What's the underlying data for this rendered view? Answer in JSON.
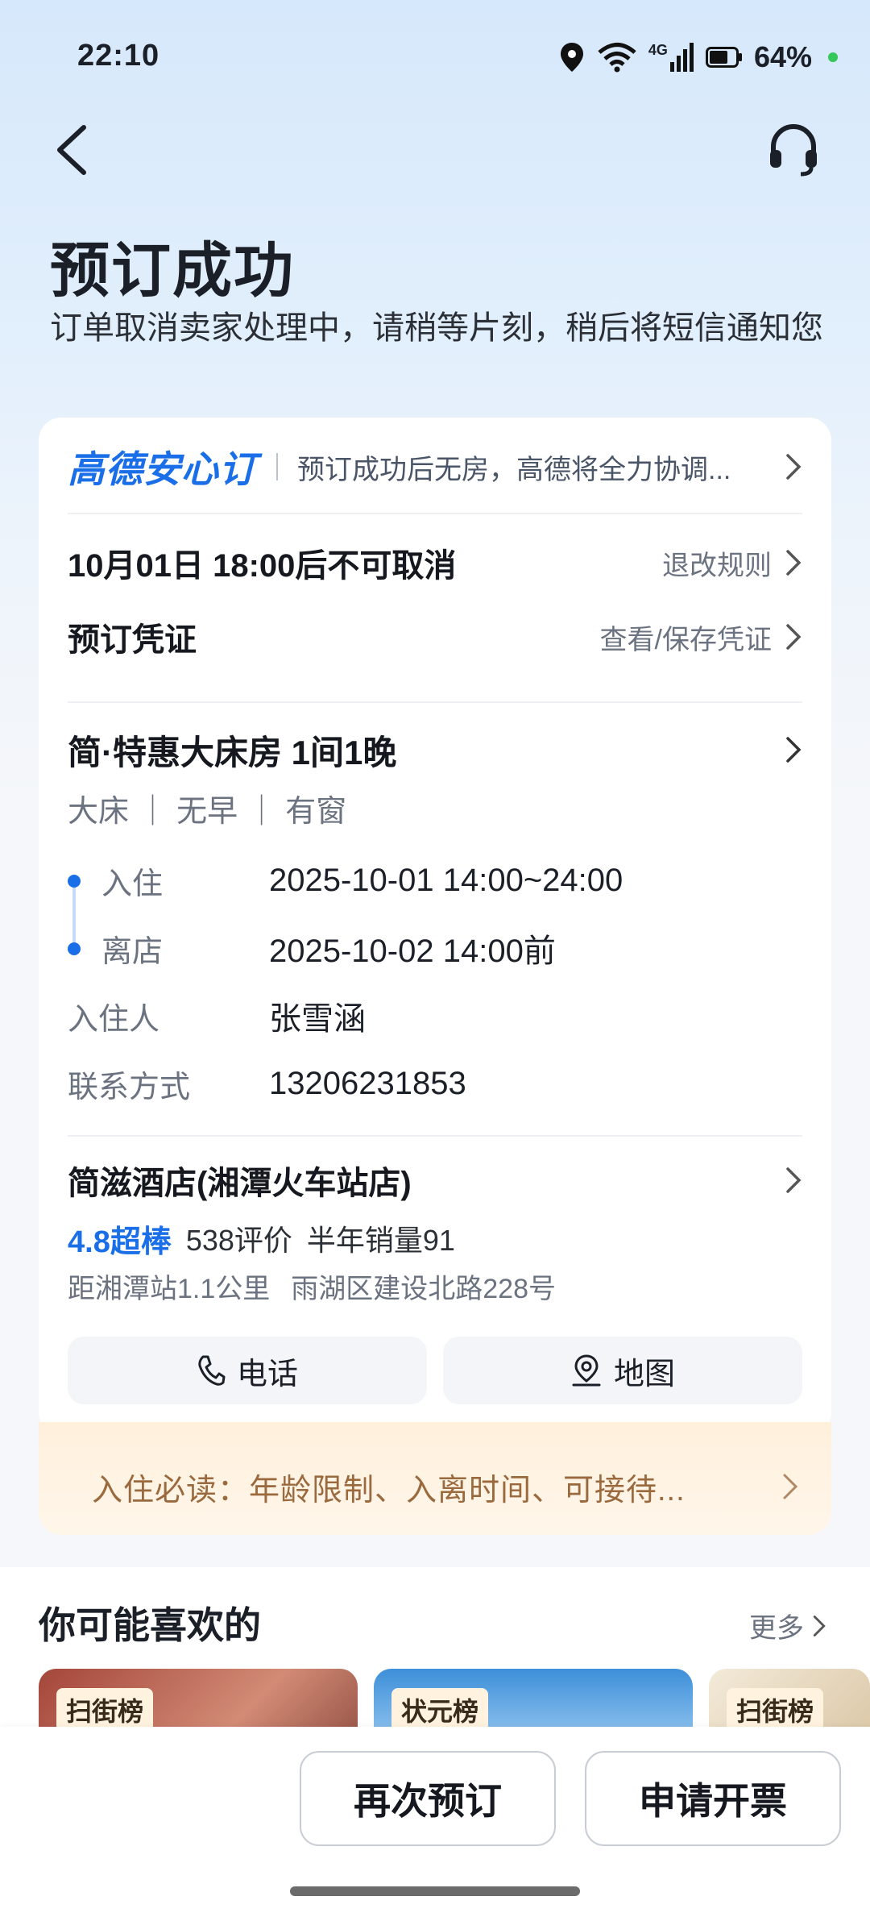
{
  "status_bar": {
    "time": "22:10",
    "network": "4G",
    "battery": "64%"
  },
  "icons": {
    "back": "back-arrow-icon",
    "customer_service": "headset-icon",
    "phone": "phone-icon",
    "map": "map-pin-icon",
    "chevron": "chevron-right-icon"
  },
  "header": {
    "title": "预订成功",
    "subtitle": "订单取消卖家处理中，请稍等片刻，稍后将短信通知您"
  },
  "assurance": {
    "brand": "高德安心订",
    "desc": "预订成功后无房，高德将全力协调..."
  },
  "policy": {
    "cancel_text": "10月01日 18:00后不可取消",
    "rules_link": "退改规则",
    "voucher_label": "预订凭证",
    "voucher_link": "查看/保存凭证"
  },
  "room": {
    "title": "简·特惠大床房 1间1晚",
    "tags": "大床 ｜ 无早 ｜ 有窗",
    "checkin_label": "入住",
    "checkin_value": "2025-10-01 14:00~24:00",
    "checkout_label": "离店",
    "checkout_value": "2025-10-02 14:00前",
    "guest_label": "入住人",
    "guest_value": "张雪涵",
    "contact_label": "联系方式",
    "contact_value": "13206231853"
  },
  "hotel": {
    "name": "简滋酒店(湘潭火车站店)",
    "score": "4.8超棒",
    "reviews": "538评价",
    "sales": "半年销量91",
    "distance": "距湘潭站1.1公里",
    "address": "雨湖区建设北路228号",
    "phone_btn": "电话",
    "map_btn": "地图"
  },
  "notice": {
    "text": "入住必读：年龄限制、入离时间、可接待..."
  },
  "recommend": {
    "title": "你可能喜欢的",
    "more": "更多",
    "cards": [
      {
        "tag": "扫街榜"
      },
      {
        "tag": "状元榜"
      },
      {
        "tag": "扫街榜"
      }
    ]
  },
  "bottom": {
    "rebook": "再次预订",
    "invoice": "申请开票"
  },
  "colors": {
    "accent": "#1a6ee8",
    "notice_bg": "#fff0dc",
    "notice_text": "#9a6a3e"
  }
}
